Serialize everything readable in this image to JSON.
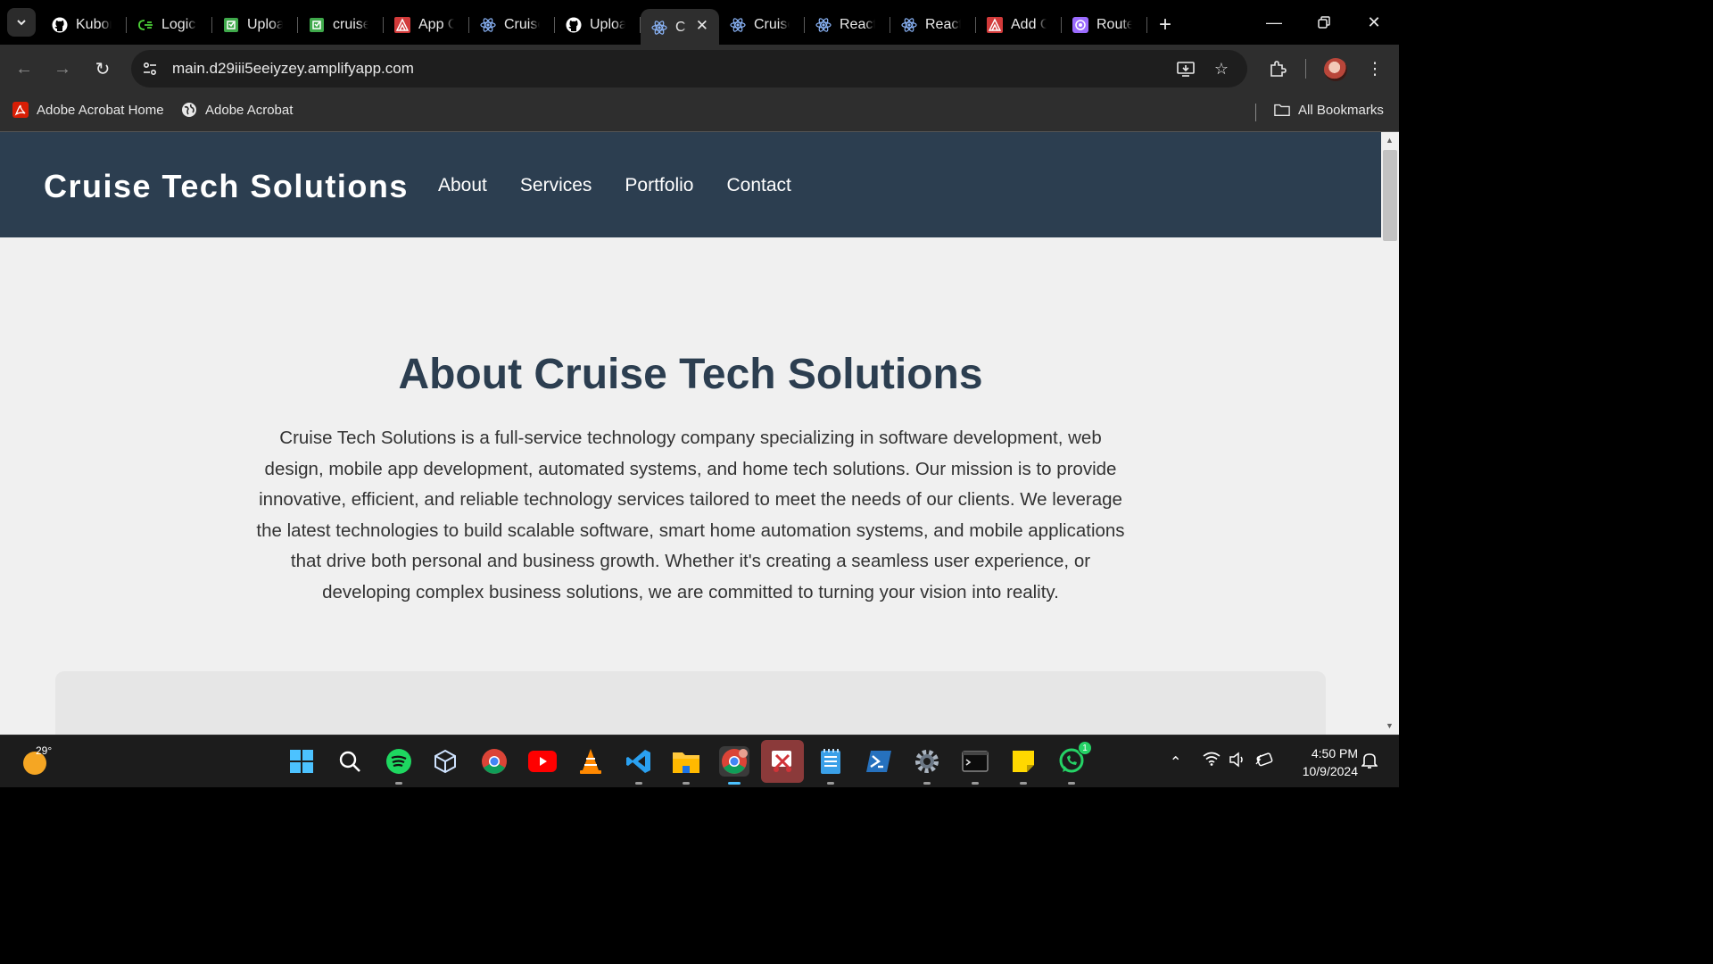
{
  "browser": {
    "tabs": [
      {
        "label": "Kubor",
        "icon": "github-icon",
        "active": false
      },
      {
        "label": "Logic",
        "icon": "leetcode-icon",
        "active": false
      },
      {
        "label": "Uploa",
        "icon": "code-box-icon",
        "active": false
      },
      {
        "label": "cruise",
        "icon": "code-box-icon",
        "active": false
      },
      {
        "label": "App C",
        "icon": "aws-amplify-icon",
        "active": false
      },
      {
        "label": "Cruise",
        "icon": "react-icon",
        "active": false
      },
      {
        "label": "Uploa",
        "icon": "github-icon",
        "active": false
      },
      {
        "label": "C",
        "icon": "react-icon",
        "active": true
      },
      {
        "label": "Cruise",
        "icon": "react-icon",
        "active": false
      },
      {
        "label": "React",
        "icon": "react-icon",
        "active": false
      },
      {
        "label": "React",
        "icon": "react-icon",
        "active": false
      },
      {
        "label": "Add C",
        "icon": "aws-amplify-icon",
        "active": false
      },
      {
        "label": "Route",
        "icon": "router-icon",
        "active": false
      }
    ],
    "url": "main.d29iii5eeiyzey.amplifyapp.com",
    "bookmarks": [
      {
        "label": "Adobe Acrobat Home",
        "icon": "acrobat-icon"
      },
      {
        "label": "Adobe Acrobat",
        "icon": "globe-icon"
      }
    ],
    "all_bookmarks_label": "All Bookmarks"
  },
  "site": {
    "brand": "Cruise Tech Solutions",
    "nav": [
      "About",
      "Services",
      "Portfolio",
      "Contact"
    ],
    "about_title": "About Cruise Tech Solutions",
    "about_body": "Cruise Tech Solutions is a full-service technology company specializing in software development, web design, mobile app development, automated systems, and home tech solutions. Our mission is to provide innovative, efficient, and reliable technology services tailored to meet the needs of our clients. We leverage the latest technologies to build scalable software, smart home automation systems, and mobile applications that drive both personal and business growth. Whether it's creating a seamless user experience, or developing complex business solutions, we are committed to turning your vision into reality.",
    "header_color": "#2c3e50"
  },
  "taskbar": {
    "weather_temp": "29°",
    "time": "4:50 PM",
    "date": "10/9/2024",
    "whatsapp_badge": "1"
  }
}
